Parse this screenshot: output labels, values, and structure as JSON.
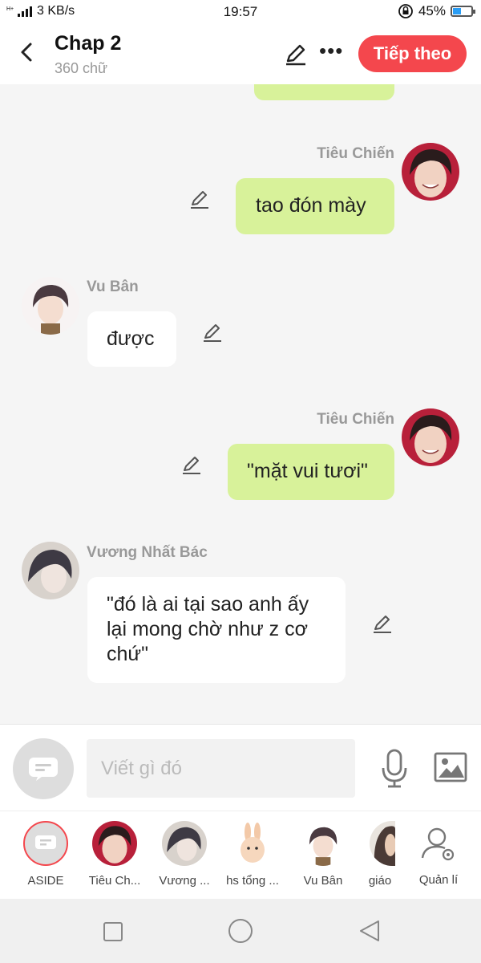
{
  "status": {
    "network": "3 KB/s",
    "time": "19:57",
    "battery": "45%",
    "battery_level": 0.45
  },
  "header": {
    "title": "Chap 2",
    "subtitle": "360 chữ",
    "next_label": "Tiếp theo"
  },
  "messages": [
    {
      "sender": "Tiêu  Chiến",
      "text": "tao đón mày",
      "side": "right"
    },
    {
      "sender": "Vu Bân",
      "text": "được",
      "side": "left"
    },
    {
      "sender": "Tiêu  Chiến",
      "text": "\"mặt vui tươi\"",
      "side": "right"
    },
    {
      "sender": "Vương Nhất Bác",
      "text_lines": [
        "\"đó là ai tại sao anh ấy",
        "lại mong chờ như z cơ",
        "chứ\""
      ],
      "side": "left"
    }
  ],
  "composer": {
    "placeholder": "Viết gì đó"
  },
  "characters": [
    {
      "label": "ASIDE"
    },
    {
      "label": "Tiêu  Ch..."
    },
    {
      "label": "Vương ..."
    },
    {
      "label": "hs tổng ..."
    },
    {
      "label": "Vu Bân"
    },
    {
      "label": "giáo"
    },
    {
      "label": "Quản lí"
    }
  ],
  "colors": {
    "accent": "#f4474d",
    "bubble_green": "#d8f29a",
    "bubble_white": "#ffffff"
  }
}
